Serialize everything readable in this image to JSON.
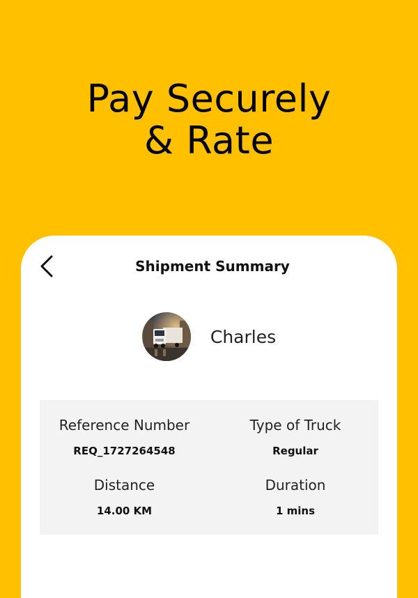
{
  "promo": {
    "headline_line1": "Pay Securely",
    "headline_line2": "& Rate"
  },
  "screen": {
    "title": "Shipment Summary",
    "back_icon": "chevron-left-icon"
  },
  "driver": {
    "name": "Charles",
    "avatar_icon": "truck-photo-avatar"
  },
  "summary": {
    "reference_label": "Reference Number",
    "reference_value": "REQ_1727264548",
    "truck_label": "Type of Truck",
    "truck_value": "Regular",
    "distance_label": "Distance",
    "distance_value": "14.00 KM",
    "duration_label": "Duration",
    "duration_value": "1 mins"
  },
  "colors": {
    "background": "#FFC000",
    "card": "#FFFFFF",
    "summary_box": "#F3F3F3"
  }
}
